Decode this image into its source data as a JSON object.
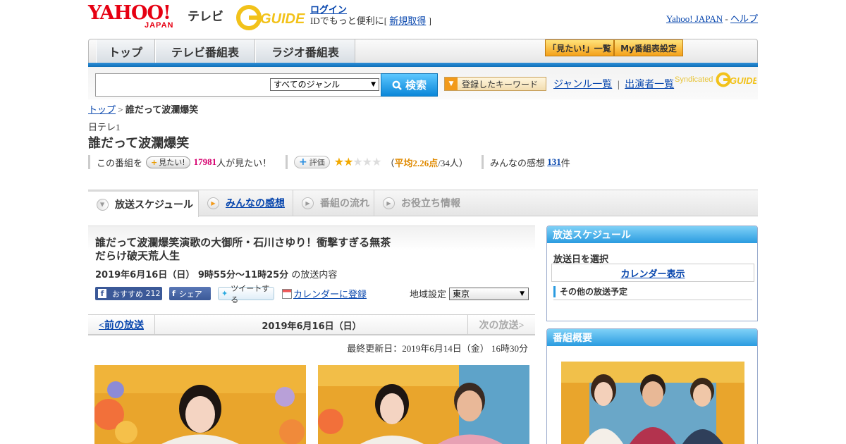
{
  "header": {
    "yahoo_logo": "YAHOO!",
    "japan_logo": "JAPAN",
    "tv_label": "テレビ",
    "gguide_logo": "G-GUIDE",
    "login": "ログイン",
    "login_prompt": "IDでもっと便利に[",
    "register": "新規取得",
    "register_close": "]",
    "yahoo_japan_link": "Yahoo! JAPAN",
    "help_sep": "-",
    "help_link": "ヘルプ"
  },
  "nav": {
    "tabs": [
      {
        "label": "トップ"
      },
      {
        "label": "テレビ番組表"
      },
      {
        "label": "ラジオ番組表"
      }
    ],
    "mitai_list": "「見たい!」一覧",
    "my_schedule": "My番組表設定"
  },
  "search": {
    "genre_selected": "すべてのジャンル",
    "button_label": "検索",
    "keyword_button": "登録したキーワード",
    "genre_list": "ジャンル一覧",
    "sep": "|",
    "performer_list": "出演者一覧",
    "syndicated": "Syndicated"
  },
  "breadcrumb": {
    "top": "トップ",
    "sep": ">",
    "current": "誰だって波瀾爆笑"
  },
  "program": {
    "channel": "日テレ1",
    "title": "誰だって波瀾爆笑"
  },
  "stats": {
    "mitai_prefix": "この番組を",
    "mitai_badge": "見たい!",
    "mitai_count": "17981",
    "mitai_suffix": "人が見たい！",
    "rate_badge": "評価",
    "rating_value": 2.26,
    "rating_max": 5,
    "avg_open": "（",
    "avg_label": "平均2.26点",
    "avg_count": "/34人）",
    "kansou_label": "みんなの感想",
    "kansou_count": "131",
    "kansou_suffix": "件"
  },
  "content_tabs": [
    {
      "label": "放送スケジュール"
    },
    {
      "label": "みんなの感想"
    },
    {
      "label": "番組の流れ"
    },
    {
      "label": "お役立ち情報"
    }
  ],
  "episode": {
    "title_line1": "誰だって波瀾爆笑演歌の大御所・石川さゆり！衝撃すぎる無茶",
    "title_line2": "だらけ破天荒人生",
    "date_time": "2019年6月16日（日） 9時55分～11時25分",
    "date_suffix": "の放送内容"
  },
  "social": {
    "fb_recommend": "おすすめ",
    "fb_recommend_count": "212",
    "fb_share": "シェア",
    "tweet": "ツイートする",
    "calendar_register": "カレンダーに登録",
    "region_label": "地域設定",
    "region_selected": "東京"
  },
  "pager": {
    "prev": "<前の放送",
    "date": "2019年6月16日（日）",
    "next": "次の放送>"
  },
  "last_updated": "最終更新日：2019年6月14日（金） 16時30分",
  "sidebar": {
    "schedule_head": "放送スケジュール",
    "select_date": "放送日を選択",
    "calendar_button": "カレンダー表示",
    "other_schedule": "その他の放送予定",
    "summary_head": "番組概要"
  },
  "colors": {
    "yahoo_red": "#e60012",
    "link_blue": "#0645ad",
    "accent_blue": "#2a9be0",
    "mitai_pink": "#d6006f",
    "star_gold": "#f2a900"
  }
}
